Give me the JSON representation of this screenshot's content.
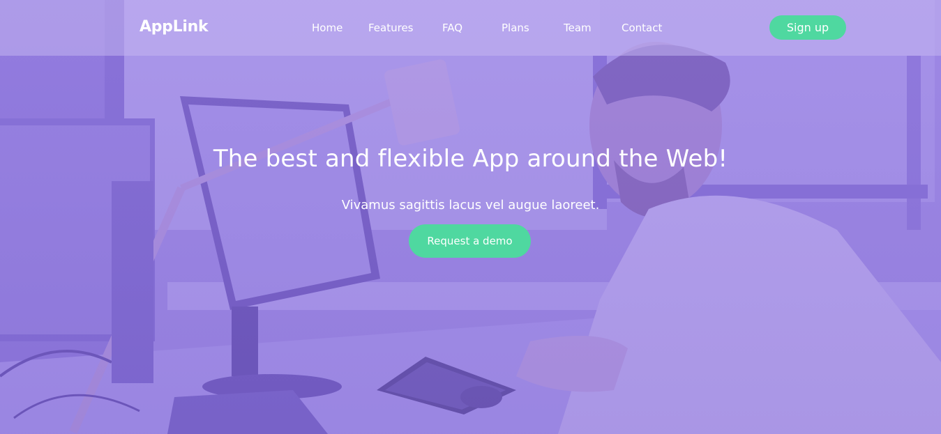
{
  "brand": {
    "name": "AppLink"
  },
  "nav": {
    "items": [
      {
        "label": "Home"
      },
      {
        "label": "Features"
      },
      {
        "label": "FAQ"
      },
      {
        "label": "Plans"
      },
      {
        "label": "Team"
      },
      {
        "label": "Contact"
      }
    ],
    "signup_label": "Sign up"
  },
  "hero": {
    "title": "The best and flexible App around the Web!",
    "subtitle": "Vivamus sagittis lacus vel augue laoreet.",
    "cta_label": "Request a demo",
    "image_description_icon": "office-worker-photo"
  },
  "colors": {
    "accent": "#4fd8a0",
    "overlay": "#8f79dc",
    "text": "#ffffff"
  }
}
